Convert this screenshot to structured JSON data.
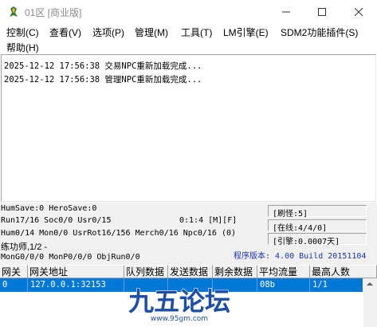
{
  "window": {
    "title": "01区 [商业版]",
    "minimize_glyph": "─",
    "maximize_glyph": "☐",
    "close_glyph": "✕"
  },
  "menu": {
    "items": [
      {
        "label": "控制(C)"
      },
      {
        "label": "查看(V)"
      },
      {
        "label": "选项(P)"
      },
      {
        "label": "管理(M)"
      },
      {
        "label": "工具(T)"
      },
      {
        "label": "LM引擎(E)"
      },
      {
        "label": "SDM2功能插件(S)"
      },
      {
        "label": "帮助(H)"
      }
    ]
  },
  "log": {
    "lines": [
      "2025-12-12 17:56:38 交易NPC重新加载完成...",
      "2025-12-12 17:56:38 管理NPC重新加载完成..."
    ]
  },
  "status": {
    "save_line": "HumSave:0 HeroSave:0",
    "run_line": "Run17/16 Soc0/0 Usr0/15",
    "clock": "0:1:4 [M][F]",
    "hum_line": "Hum0/14 Mon0/0 UsrRot16/156 Merch0/16 Npc0/16 (0)",
    "practice_line": "练功师,1/2 -",
    "mon_line": "MonG0/0/0 MonP0/0/0 ObjRun0/0",
    "refresh_monster": "[刷怪:5]",
    "online": "[在线:4/4/0]",
    "engine": "[引擎:0.0007天]",
    "version": "程序版本: 4.00 Build 20151104"
  },
  "grid": {
    "columns": [
      "网关",
      "网关地址",
      "队列数据",
      "发送数据",
      "剩余数据",
      "平均流量",
      "最高人数"
    ],
    "rows": [
      [
        "0",
        "127.0.0.1:32153",
        "",
        "",
        "",
        "08b",
        "1/1"
      ]
    ]
  },
  "watermark": {
    "logo_text": "九五论坛",
    "url": "www.95gm.com"
  },
  "colors": {
    "selection": "#0078d7",
    "version_text": "#1a35b8",
    "watermark": "#1e4fa8"
  }
}
